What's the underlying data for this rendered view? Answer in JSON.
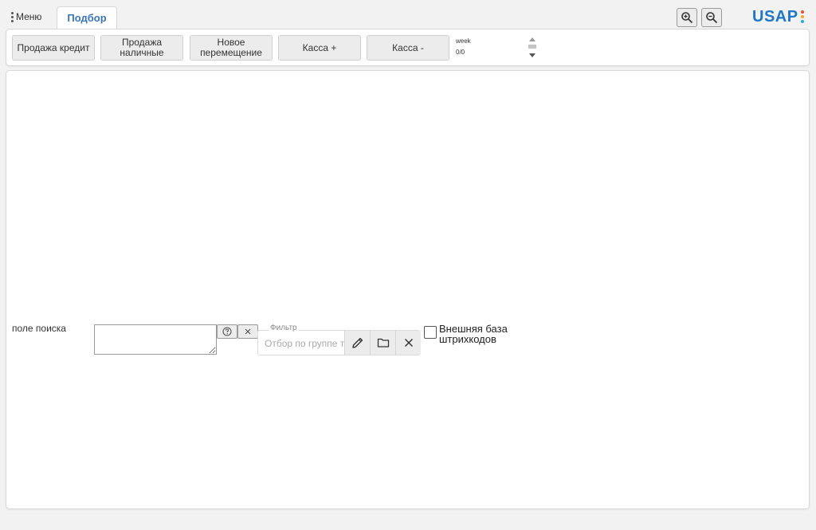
{
  "header": {
    "menu_label": "Меню",
    "active_tab": "Подбор",
    "zoom_in_icon": "zoom-in-icon",
    "zoom_out_icon": "zoom-out-icon",
    "logo_text": "USAP",
    "logo_dot_colors": [
      "#e94e3c",
      "#f6a623",
      "#27a9e1"
    ]
  },
  "toolbar": {
    "buttons": [
      {
        "label": "Продажа кредит"
      },
      {
        "label": "Продажа наличные"
      },
      {
        "label": "Новое перемещение"
      },
      {
        "label": "Касса +"
      },
      {
        "label": "Касса -"
      }
    ],
    "info_lines": [
      "week",
      "0/0",
      "0"
    ]
  },
  "search": {
    "label": "поле поиска",
    "value": "",
    "help_icon": "help-circle-icon",
    "clear_icon": "close-icon"
  },
  "filter": {
    "legend": "Фильтр",
    "placeholder": "Отбор по группе товаров",
    "edit_icon": "pencil-icon",
    "folder_icon": "folder-icon",
    "clear_icon": "close-icon"
  },
  "external_barcode": {
    "label": "Внешняя база штрихкодов",
    "checked": false
  },
  "colors": {
    "accent": "#3b73b9",
    "logo": "#1e77c8",
    "background": "#f2f2f2"
  }
}
